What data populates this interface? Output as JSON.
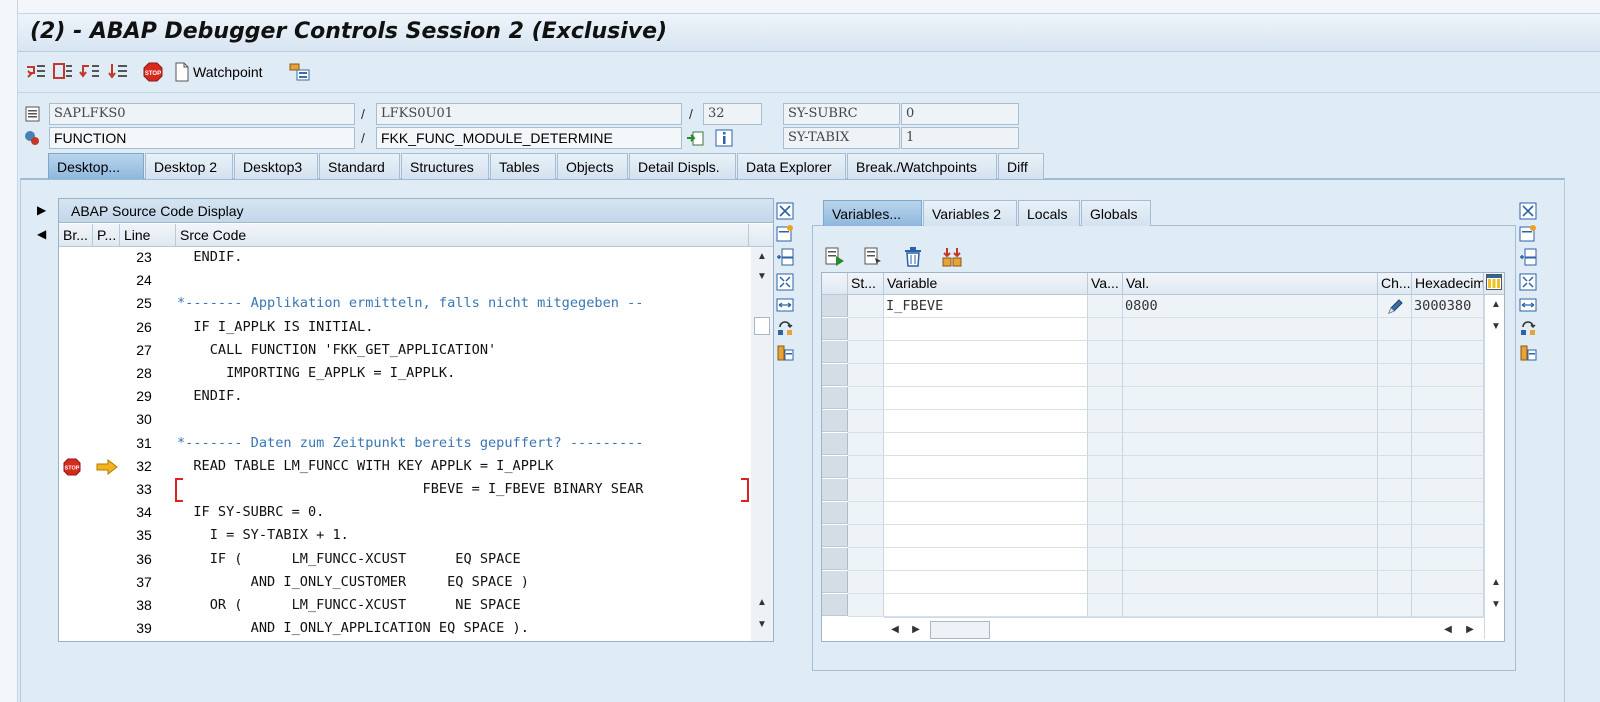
{
  "window": {
    "title": "(2) - ABAP Debugger Controls Session 2 (Exclusive)"
  },
  "toolbar": {
    "icons": [
      "single-step-icon",
      "execute-icon",
      "return-icon",
      "continue-icon",
      "stop-icon",
      "watchpoint-icon",
      "layout-icon"
    ],
    "watchpoint_label": "Watchpoint"
  },
  "context": {
    "program": "SAPLFKS0",
    "include": "LFKS0U01",
    "line": "32",
    "event_type": "FUNCTION",
    "event_name": "FKK_FUNC_MODULE_DETERMINE",
    "sysfield1_name": "SY-SUBRC",
    "sysfield1_value": "0",
    "sysfield2_name": "SY-TABIX",
    "sysfield2_value": "1",
    "slash": "/"
  },
  "tabs": [
    "Desktop...",
    "Desktop 2",
    "Desktop3",
    "Standard",
    "Structures",
    "Tables",
    "Objects",
    "Detail Displs.",
    "Data Explorer",
    "Break./Watchpoints",
    "Diff"
  ],
  "source": {
    "title": "ABAP Source Code Display",
    "headers": {
      "br": "Br...",
      "p": "P...",
      "line": "Line",
      "code": "Srce Code"
    },
    "lines": [
      {
        "n": "23",
        "code": "  ENDIF."
      },
      {
        "n": "24",
        "code": ""
      },
      {
        "n": "25",
        "code": "*------- Applikation ermitteln, falls nicht mitgegeben --"
      },
      {
        "n": "26",
        "code": "  IF I_APPLK IS INITIAL."
      },
      {
        "n": "27",
        "code": "    CALL FUNCTION 'FKK_GET_APPLICATION'"
      },
      {
        "n": "28",
        "code": "      IMPORTING E_APPLK = I_APPLK."
      },
      {
        "n": "29",
        "code": "  ENDIF."
      },
      {
        "n": "30",
        "code": ""
      },
      {
        "n": "31",
        "code": "*------- Daten zum Zeitpunkt bereits gepuffert? ---------"
      },
      {
        "n": "32",
        "code": "  READ TABLE LM_FUNCC WITH KEY APPLK = I_APPLK"
      },
      {
        "n": "33",
        "code": "                              FBEVE = I_FBEVE BINARY SEAR"
      },
      {
        "n": "34",
        "code": "  IF SY-SUBRC = 0."
      },
      {
        "n": "35",
        "code": "    I = SY-TABIX + 1."
      },
      {
        "n": "36",
        "code": "    IF (      LM_FUNCC-XCUST      EQ SPACE"
      },
      {
        "n": "37",
        "code": "         AND I_ONLY_CUSTOMER     EQ SPACE )"
      },
      {
        "n": "38",
        "code": "    OR (      LM_FUNCC-XCUST      NE SPACE"
      },
      {
        "n": "39",
        "code": "         AND I_ONLY_APPLICATION EQ SPACE )."
      }
    ]
  },
  "vartabs": [
    "Variables...",
    "Variables 2",
    "Locals",
    "Globals"
  ],
  "vargrid": {
    "headers": {
      "st": "St...",
      "variable": "Variable",
      "va": "Va...",
      "val": "Val.",
      "ch": "Ch...",
      "hex": "Hexadecim"
    },
    "rows": [
      {
        "variable": "I_FBEVE",
        "val": "0800",
        "hex": "3000380"
      }
    ]
  },
  "colors": {
    "background": "#dfebf5",
    "active_tab": "#8fb8dd",
    "comment": "#3a76b4"
  }
}
